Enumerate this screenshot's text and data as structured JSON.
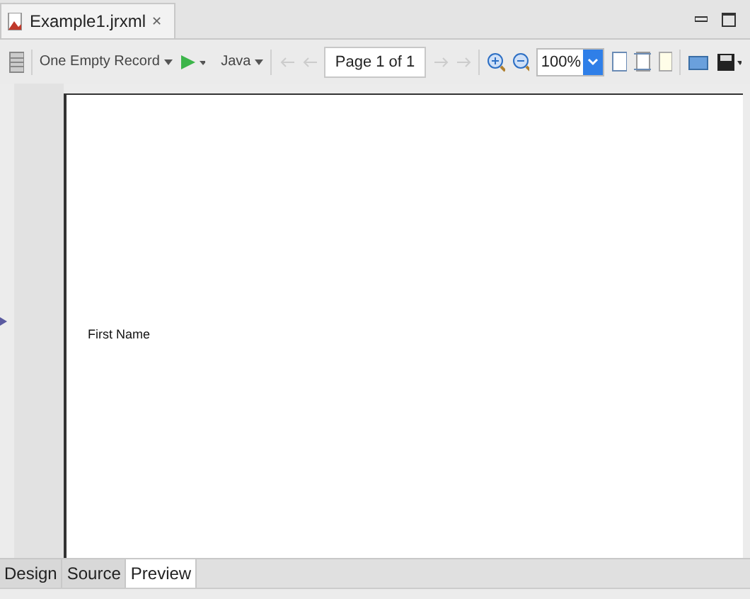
{
  "editor_tab": {
    "title": "Example1.jrxml",
    "close": "✕"
  },
  "toolbar": {
    "data_source": "One Empty Record",
    "language": "Java",
    "page_field": {
      "value": "Page 1 of 1"
    },
    "zoom": {
      "value": "100%"
    }
  },
  "page": {
    "fields": [
      {
        "text": "First Name"
      }
    ]
  },
  "bottom_tabs": [
    {
      "label": "Design",
      "selected": false
    },
    {
      "label": "Source",
      "selected": false
    },
    {
      "label": "Preview",
      "selected": true
    }
  ]
}
